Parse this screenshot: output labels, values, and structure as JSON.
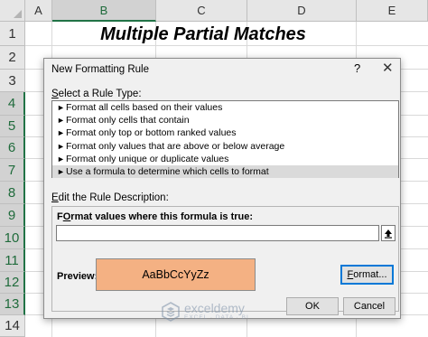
{
  "sheet": {
    "columns": [
      "A",
      "B",
      "C",
      "D",
      "E"
    ],
    "rows": [
      "1",
      "2",
      "3",
      "4",
      "5",
      "6",
      "7",
      "8",
      "9",
      "10",
      "11",
      "12",
      "13",
      "14"
    ],
    "selected_column": "B",
    "title": "Multiple Partial Matches"
  },
  "dialog": {
    "title": "New Formatting Rule",
    "help": "?",
    "close": "✕",
    "select_rule_label_key": "S",
    "select_rule_label_rest": "elect a Rule Type:",
    "rule_types": [
      "Format all cells based on their values",
      "Format only cells that contain",
      "Format only top or bottom ranked values",
      "Format only values that are above or below average",
      "Format only unique or duplicate values",
      "Use a formula to determine which cells to format"
    ],
    "selected_rule_index": 5,
    "edit_label_key": "E",
    "edit_label_rest": "dit the Rule Description:",
    "formula_label_key": "O",
    "formula_label_pre": "F",
    "formula_label_rest": "rmat values where this formula is true:",
    "formula_value": "",
    "preview_label": "Preview:",
    "preview_text": "AaBbCcYyZz",
    "preview_fill_color": "#f4b183",
    "format_button_key": "F",
    "format_button_rest": "ormat...",
    "ok_label": "OK",
    "cancel_label": "Cancel"
  },
  "watermark": {
    "name": "exceldemy",
    "tagline": "EXCEL · DATA · BI"
  }
}
